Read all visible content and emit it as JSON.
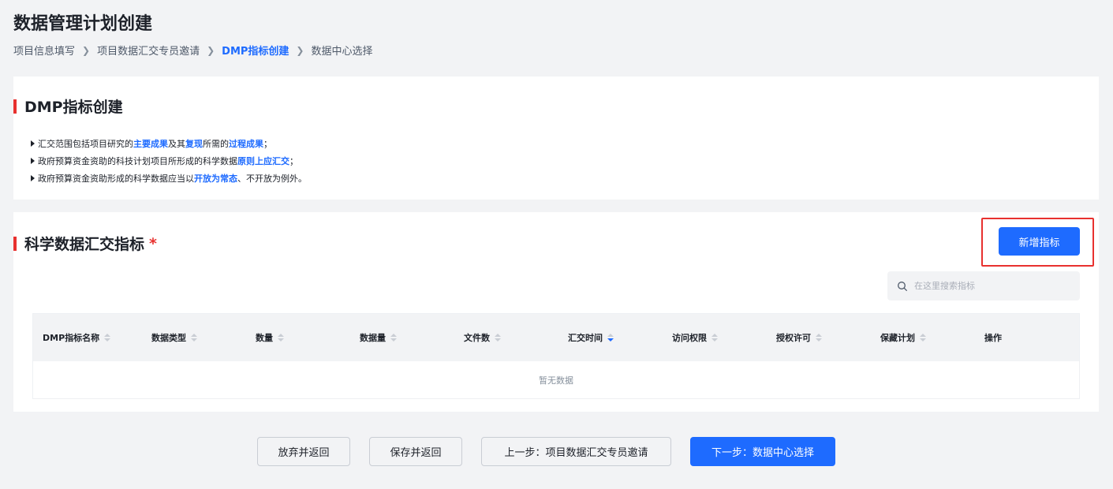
{
  "page": {
    "title": "数据管理计划创建",
    "breadcrumb": [
      "项目信息填写",
      "项目数据汇交专员邀请",
      "DMP指标创建",
      "数据中心选择"
    ],
    "breadcrumb_active_index": 2
  },
  "intro": {
    "title": "DMP指标创建",
    "tips": [
      [
        {
          "text": "汇交范围包括项目研究的",
          "hl": false
        },
        {
          "text": "主要成果",
          "hl": true
        },
        {
          "text": "及其",
          "hl": false
        },
        {
          "text": "复现",
          "hl": true
        },
        {
          "text": "所需的",
          "hl": false
        },
        {
          "text": "过程成果",
          "hl": true
        },
        {
          "text": "；",
          "hl": false
        }
      ],
      [
        {
          "text": "政府预算资金资助的科技计划项目所形成的科学数据",
          "hl": false
        },
        {
          "text": "原则上应汇交",
          "hl": true
        },
        {
          "text": "；",
          "hl": false
        }
      ],
      [
        {
          "text": "政府预算资金资助形成的科学数据应当以",
          "hl": false
        },
        {
          "text": "开放为常态",
          "hl": true
        },
        {
          "text": "、不开放为例外。",
          "hl": false
        }
      ]
    ]
  },
  "indicators": {
    "title": "科学数据汇交指标",
    "required_mark": "*",
    "add_button": "新增指标",
    "search_placeholder": "在这里搜索指标",
    "columns": [
      {
        "label": "DMP指标名称",
        "sortable": true,
        "active": false
      },
      {
        "label": "数据类型",
        "sortable": true,
        "active": false
      },
      {
        "label": "数量",
        "sortable": true,
        "active": false
      },
      {
        "label": "数据量",
        "sortable": true,
        "active": false
      },
      {
        "label": "文件数",
        "sortable": true,
        "active": false
      },
      {
        "label": "汇交时间",
        "sortable": true,
        "active": true
      },
      {
        "label": "访问权限",
        "sortable": true,
        "active": false
      },
      {
        "label": "授权许可",
        "sortable": true,
        "active": false
      },
      {
        "label": "保藏计划",
        "sortable": true,
        "active": false
      },
      {
        "label": "操作",
        "sortable": false,
        "active": false
      }
    ],
    "empty_text": "暂无数据"
  },
  "footer": {
    "discard": "放弃并返回",
    "save": "保存并返回",
    "prev": "上一步：项目数据汇交专员邀请",
    "next": "下一步：数据中心选择"
  },
  "colors": {
    "primary": "#1e6bff",
    "accent_red": "#e8312f"
  }
}
